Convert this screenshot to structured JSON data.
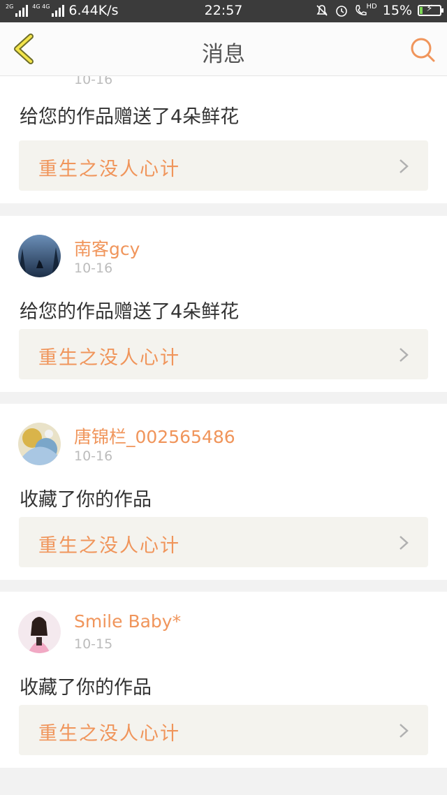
{
  "status_bar": {
    "net_tags": [
      "2G",
      "4G 4G"
    ],
    "speed": "6.44K/s",
    "time": "22:57",
    "hd_label": "HD",
    "battery_text": "15%",
    "battery_level": 0.15
  },
  "header": {
    "title": "消息"
  },
  "colors": {
    "accent": "#f0955b",
    "link_bg": "#f4f3ee",
    "date": "#bcbcbc"
  },
  "messages": [
    {
      "user": "",
      "date": "10-16",
      "action": "给您的作品赠送了4朵鲜花",
      "work": "重生之没人心计",
      "avatar": "night-forest"
    },
    {
      "user": "南客gcy",
      "date": "10-16",
      "action": "给您的作品赠送了4朵鲜花",
      "work": "重生之没人心计",
      "avatar": "wolf-forest"
    },
    {
      "user": "唐锦栏_002565486",
      "date": "10-16",
      "action": "收藏了你的作品",
      "work": "重生之没人心计",
      "avatar": "anime-art"
    },
    {
      "user": "Smile Baby*",
      "date": "10-15",
      "action": "收藏了你的作品",
      "work": "重生之没人心计",
      "avatar": "girl-photo"
    }
  ]
}
